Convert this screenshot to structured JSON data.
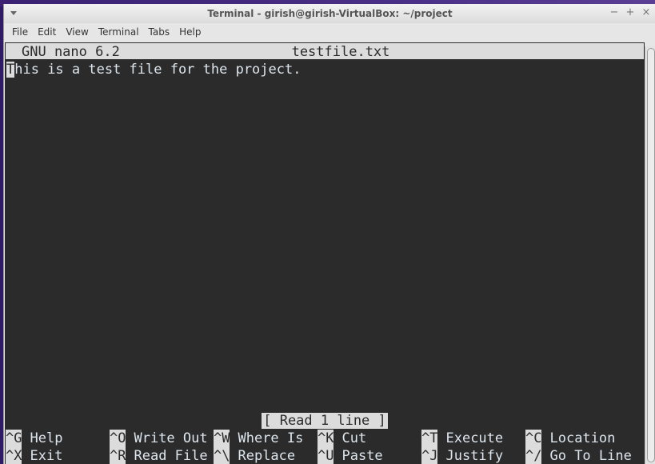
{
  "window": {
    "title": "Terminal - girish@girish-VirtualBox: ~/project",
    "controls": {
      "minimize": "−",
      "maximize": "+",
      "close": "×"
    }
  },
  "menubar": {
    "items": [
      {
        "label": "File"
      },
      {
        "label": "Edit"
      },
      {
        "label": "View"
      },
      {
        "label": "Terminal"
      },
      {
        "label": "Tabs"
      },
      {
        "label": "Help"
      }
    ]
  },
  "nano": {
    "version": "GNU nano 6.2",
    "filename": "testfile.txt",
    "cursor_char": "T",
    "line_rest": "his is a test file for the project.",
    "status": "[ Read 1 line ]",
    "shortcuts": [
      [
        {
          "key": "^G",
          "label": "Help"
        },
        {
          "key": "^O",
          "label": "Write Out"
        },
        {
          "key": "^W",
          "label": "Where Is"
        },
        {
          "key": "^K",
          "label": "Cut"
        },
        {
          "key": "^T",
          "label": "Execute"
        },
        {
          "key": "^C",
          "label": "Location"
        }
      ],
      [
        {
          "key": "^X",
          "label": "Exit"
        },
        {
          "key": "^R",
          "label": "Read File"
        },
        {
          "key": "^\\",
          "label": "Replace"
        },
        {
          "key": "^U",
          "label": "Paste"
        },
        {
          "key": "^J",
          "label": "Justify"
        },
        {
          "key": "^/",
          "label": "Go To Line"
        }
      ]
    ]
  }
}
